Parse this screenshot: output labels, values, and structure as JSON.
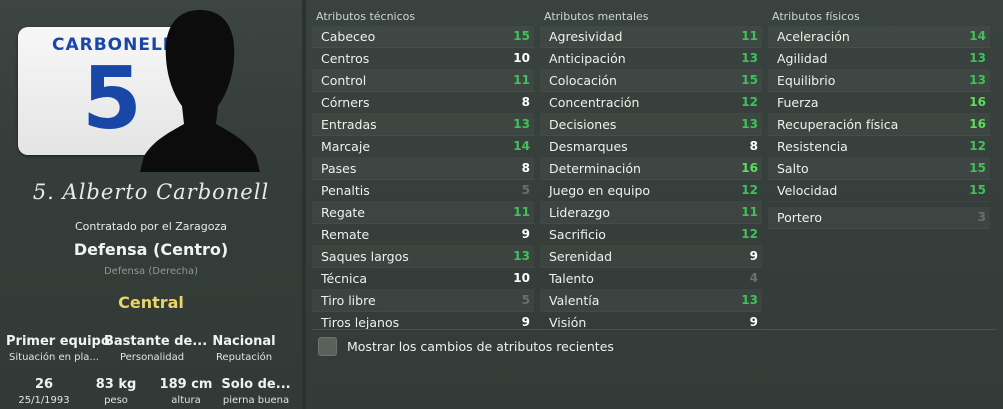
{
  "player": {
    "shirt_name": "CARBONELL",
    "shirt_number": "5",
    "signature": "5. Alberto Carbonell",
    "contract": "Contratado por el Zaragoza",
    "position": "Defensa (Centro)",
    "position_secondary": "Defensa (Derecha)",
    "role": "Central"
  },
  "info_row1": [
    {
      "value": "Primer equipo",
      "label": "Situación en pla..."
    },
    {
      "value": "Bastante de...",
      "label": "Personalidad"
    },
    {
      "value": "Nacional",
      "label": "Reputación"
    }
  ],
  "info_row2": [
    {
      "value": "26",
      "label": "25/1/1993"
    },
    {
      "value": "83 kg",
      "label": "peso"
    },
    {
      "value": "189 cm",
      "label": "altura"
    },
    {
      "value": "Solo de...",
      "label": "pierna buena"
    }
  ],
  "columns": [
    {
      "title": "Atributos técnicos",
      "items": [
        {
          "name": "Cabeceo",
          "value": "15",
          "color": "#3ec35a"
        },
        {
          "name": "Centros",
          "value": "10",
          "color": "#ffffff"
        },
        {
          "name": "Control",
          "value": "11",
          "color": "#3ec35a"
        },
        {
          "name": "Córners",
          "value": "8",
          "color": "#ffffff"
        },
        {
          "name": "Entradas",
          "value": "13",
          "color": "#3ec35a"
        },
        {
          "name": "Marcaje",
          "value": "14",
          "color": "#3ec35a"
        },
        {
          "name": "Pases",
          "value": "8",
          "color": "#ffffff"
        },
        {
          "name": "Penaltis",
          "value": "5",
          "color": "#69716d"
        },
        {
          "name": "Regate",
          "value": "11",
          "color": "#3ec35a"
        },
        {
          "name": "Remate",
          "value": "9",
          "color": "#ffffff"
        },
        {
          "name": "Saques largos",
          "value": "13",
          "color": "#3ec35a"
        },
        {
          "name": "Técnica",
          "value": "10",
          "color": "#ffffff"
        },
        {
          "name": "Tiro libre",
          "value": "5",
          "color": "#69716d"
        },
        {
          "name": "Tiros lejanos",
          "value": "9",
          "color": "#ffffff"
        }
      ]
    },
    {
      "title": "Atributos mentales",
      "items": [
        {
          "name": "Agresividad",
          "value": "11",
          "color": "#3ec35a"
        },
        {
          "name": "Anticipación",
          "value": "13",
          "color": "#3ec35a"
        },
        {
          "name": "Colocación",
          "value": "15",
          "color": "#3ec35a"
        },
        {
          "name": "Concentración",
          "value": "12",
          "color": "#3ec35a"
        },
        {
          "name": "Decisiones",
          "value": "13",
          "color": "#3ec35a"
        },
        {
          "name": "Desmarques",
          "value": "8",
          "color": "#ffffff"
        },
        {
          "name": "Determinación",
          "value": "16",
          "color": "#5be05a"
        },
        {
          "name": "Juego en equipo",
          "value": "12",
          "color": "#3ec35a"
        },
        {
          "name": "Liderazgo",
          "value": "11",
          "color": "#3ec35a"
        },
        {
          "name": "Sacrificio",
          "value": "12",
          "color": "#3ec35a"
        },
        {
          "name": "Serenidad",
          "value": "9",
          "color": "#ffffff"
        },
        {
          "name": "Talento",
          "value": "4",
          "color": "#69716d"
        },
        {
          "name": "Valentía",
          "value": "13",
          "color": "#3ec35a"
        },
        {
          "name": "Visión",
          "value": "9",
          "color": "#ffffff"
        }
      ]
    },
    {
      "title": "Atributos físicos",
      "items": [
        {
          "name": "Aceleración",
          "value": "14",
          "color": "#3ec35a"
        },
        {
          "name": "Agilidad",
          "value": "13",
          "color": "#3ec35a"
        },
        {
          "name": "Equilibrio",
          "value": "13",
          "color": "#3ec35a"
        },
        {
          "name": "Fuerza",
          "value": "16",
          "color": "#5be05a"
        },
        {
          "name": "Recuperación física",
          "value": "16",
          "color": "#5be05a"
        },
        {
          "name": "Resistencia",
          "value": "12",
          "color": "#3ec35a"
        },
        {
          "name": "Salto",
          "value": "15",
          "color": "#3ec35a"
        },
        {
          "name": "Velocidad",
          "value": "15",
          "color": "#3ec35a"
        },
        {
          "name": "Portero",
          "value": "3",
          "color": "#69716d"
        }
      ]
    }
  ],
  "toggle": {
    "label": "Mostrar los cambios de atributos recientes",
    "checked": false
  }
}
